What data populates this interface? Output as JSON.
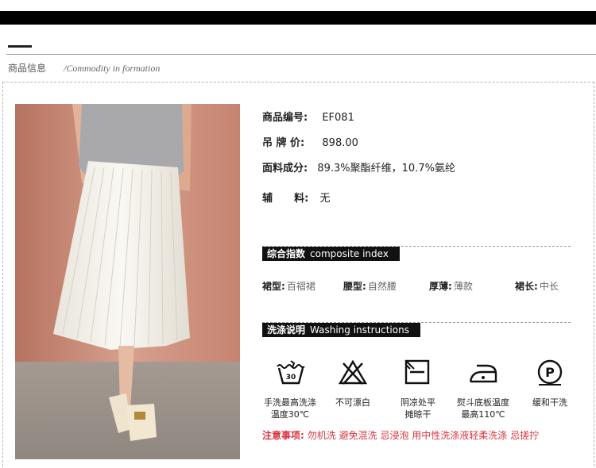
{
  "header": {
    "section_title_cn": "商品信息",
    "section_title_en": "/Commodity in formation"
  },
  "product": {
    "fields": [
      {
        "label": "商品编号:",
        "value": "EF081"
      },
      {
        "label": "吊 牌 价:",
        "value": "898.00"
      },
      {
        "label": "面料成分:",
        "value": "89.3%聚酯纤维，10.7%氨纶"
      },
      {
        "label": "辅      料:",
        "value": "无"
      }
    ]
  },
  "composite": {
    "title_cn": "综合指数",
    "title_en": "composite index",
    "attributes": [
      {
        "label": "裙型:",
        "value": "百褶裙"
      },
      {
        "label": "腰型:",
        "value": "自然腰"
      },
      {
        "label": "厚薄:",
        "value": "薄款"
      },
      {
        "label": "裙长:",
        "value": "中长"
      }
    ]
  },
  "washing": {
    "title_cn": "洗涤说明",
    "title_en": "Washing instructions",
    "items": [
      {
        "icon": "hand-wash-icon",
        "line1": "手洗最高洗涤",
        "line2": "温度30℃"
      },
      {
        "icon": "no-bleach-icon",
        "line1": "不可漂白",
        "line2": ""
      },
      {
        "icon": "dry-flat-shade-icon",
        "line1": "阴凉处平",
        "line2": "摊晾干"
      },
      {
        "icon": "iron-icon",
        "line1": "熨斗底板温度",
        "line2": "最高110℃"
      },
      {
        "icon": "dry-clean-icon",
        "line1": "缓和干洗",
        "line2": ""
      }
    ],
    "notice_label": "注意事项:",
    "notice_text": "勿机洗 避免混洗 忌浸泡 用中性洗涤液轻柔洗涤 忌搓拧"
  },
  "colors": {
    "notice": "#d9363e",
    "photo_wall": "#c98f7d",
    "skirt": "#f2efe8"
  }
}
